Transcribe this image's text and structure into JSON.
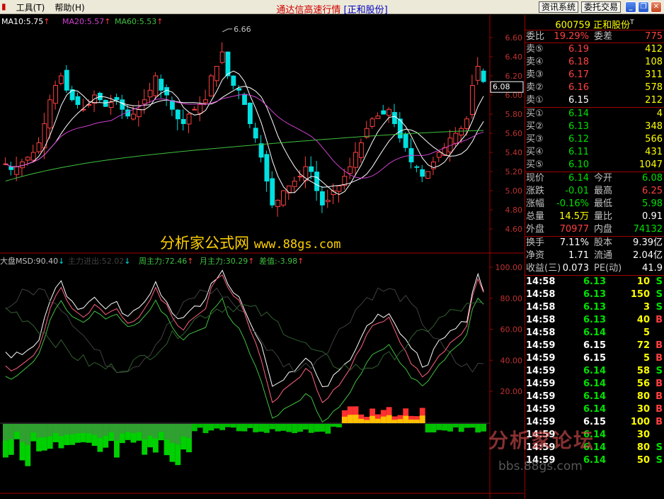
{
  "menubar": {
    "menu_items": [
      "工具",
      "帮助"
    ],
    "menu_shortcuts": [
      "(T)",
      "(H)"
    ],
    "app_title": "通达信高速行情",
    "stock_bracket": "[正和股份]",
    "btn_news": "资讯系统",
    "btn_trade": "委托交易"
  },
  "ma_labels": {
    "ma10": "MA10:5.75",
    "ma20": "MA20:5.57",
    "ma60": "MA60:5.53",
    "arrow": "↑"
  },
  "price_axis": [
    "6.60",
    "6.40",
    "6.20",
    "6.08",
    "6.00",
    "5.80",
    "5.60",
    "5.40",
    "5.20",
    "5.00",
    "4.80",
    "4.60"
  ],
  "current_price_tag": "6.08",
  "peak_label": "6.66",
  "indicator_labels": {
    "dapan": "大盘MSD:90.40",
    "zhuli_in_out": "主力进出:52.02",
    "week_main": "周主力:72.46",
    "month_main": "月主力:30.29",
    "diff": "差值:-3.98"
  },
  "indicator_axis": [
    "100.00",
    "80.00",
    "60.00",
    "40.00",
    "20.00"
  ],
  "watermark": {
    "text": "分析家公式网",
    "url": "www.88gs.com"
  },
  "logo_watermark": {
    "text": "分析家论坛",
    "url": "bbs.88gs.com"
  },
  "colors": {
    "up": "#ff4040",
    "down": "#00e0e0",
    "ma10": "#ffffff",
    "ma20": "#d040d0",
    "ma60": "#40c040",
    "axis": "#a00000"
  },
  "quote": {
    "code": "600759",
    "name": "正和股份",
    "flag": "T",
    "weibi_label": "委比",
    "weibi": "19.29%",
    "weicha_label": "委差",
    "weicha": "775",
    "asks": [
      {
        "label": "卖⑤",
        "price": "6.19",
        "vol": "412"
      },
      {
        "label": "卖④",
        "price": "6.18",
        "vol": "108"
      },
      {
        "label": "卖③",
        "price": "6.17",
        "vol": "311"
      },
      {
        "label": "卖②",
        "price": "6.16",
        "vol": "578"
      },
      {
        "label": "卖①",
        "price": "6.15",
        "vol": "212"
      }
    ],
    "bids": [
      {
        "label": "买①",
        "price": "6.14",
        "vol": "4"
      },
      {
        "label": "买②",
        "price": "6.13",
        "vol": "348"
      },
      {
        "label": "买③",
        "price": "6.12",
        "vol": "566"
      },
      {
        "label": "买④",
        "price": "6.11",
        "vol": "431"
      },
      {
        "label": "买⑤",
        "price": "6.10",
        "vol": "1047"
      }
    ],
    "stats": [
      {
        "l1": "现价",
        "v1": "6.14",
        "c1": "green",
        "l2": "今开",
        "v2": "6.08",
        "c2": "green"
      },
      {
        "l1": "涨跌",
        "v1": "-0.01",
        "c1": "green",
        "l2": "最高",
        "v2": "6.25",
        "c2": "red"
      },
      {
        "l1": "涨幅",
        "v1": "-0.16%",
        "c1": "green",
        "l2": "最低",
        "v2": "5.98",
        "c2": "green"
      },
      {
        "l1": "总量",
        "v1": "14.5万",
        "c1": "yellow",
        "l2": "量比",
        "v2": "0.91",
        "c2": "white"
      },
      {
        "l1": "外盘",
        "v1": "70977",
        "c1": "red",
        "l2": "内盘",
        "v2": "74132",
        "c2": "green"
      }
    ],
    "stats2": [
      {
        "l1": "换手",
        "v1": "7.11%",
        "c1": "white",
        "l2": "股本",
        "v2": "9.39亿",
        "c2": "white"
      },
      {
        "l1": "净资",
        "v1": "1.71",
        "c1": "white",
        "l2": "流通",
        "v2": "2.04亿",
        "c2": "white"
      },
      {
        "l1": "收益(三)",
        "v1": "0.073",
        "c1": "white",
        "l2": "PE(动)",
        "v2": "41.9",
        "c2": "white"
      }
    ]
  },
  "ticks": [
    {
      "time": "14:58",
      "price": "6.13",
      "vol": "10",
      "side": "S"
    },
    {
      "time": "14:58",
      "price": "6.13",
      "vol": "150",
      "side": "S"
    },
    {
      "time": "14:58",
      "price": "6.13",
      "vol": "3",
      "side": "S"
    },
    {
      "time": "14:58",
      "price": "6.13",
      "vol": "40",
      "side": "B"
    },
    {
      "time": "14:58",
      "price": "6.14",
      "vol": "5",
      "side": ""
    },
    {
      "time": "14:59",
      "price": "6.15",
      "vol": "72",
      "side": "B"
    },
    {
      "time": "14:59",
      "price": "6.15",
      "vol": "5",
      "side": "B"
    },
    {
      "time": "14:59",
      "price": "6.14",
      "vol": "58",
      "side": "S"
    },
    {
      "time": "14:59",
      "price": "6.14",
      "vol": "56",
      "side": "B"
    },
    {
      "time": "14:59",
      "price": "6.14",
      "vol": "80",
      "side": "B"
    },
    {
      "time": "14:59",
      "price": "6.14",
      "vol": "30",
      "side": "B"
    },
    {
      "time": "14:59",
      "price": "6.15",
      "vol": "100",
      "side": "B"
    },
    {
      "time": "14:59",
      "price": "6.14",
      "vol": "30",
      "side": ""
    },
    {
      "time": "14:59",
      "price": "6.14",
      "vol": "80",
      "side": "S"
    },
    {
      "time": "14:59",
      "price": "6.14",
      "vol": "50",
      "side": "S"
    }
  ]
}
